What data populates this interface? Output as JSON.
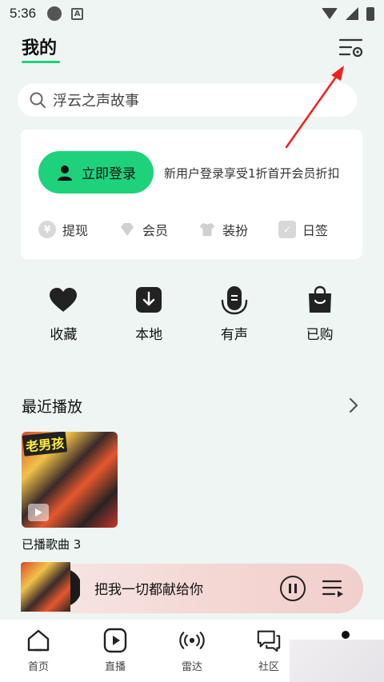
{
  "status_bar": {
    "time": "5:36",
    "a_icon_letter": "A"
  },
  "header": {
    "title": "我的",
    "accent_color": "#1ed27c"
  },
  "search": {
    "placeholder": "浮云之声故事"
  },
  "login_card": {
    "login_label": "立即登录",
    "promo_text": "新用户登录享受1折首开会员折扣",
    "quick_items": [
      {
        "label": "提现",
        "icon": "yen-icon"
      },
      {
        "label": "会员",
        "icon": "diamond-icon"
      },
      {
        "label": "装扮",
        "icon": "shirt-icon"
      },
      {
        "label": "日签",
        "icon": "checkbox-icon"
      }
    ]
  },
  "shortcuts": [
    {
      "label": "收藏",
      "icon": "heart-icon"
    },
    {
      "label": "本地",
      "icon": "download-icon"
    },
    {
      "label": "有声",
      "icon": "audiobook-icon"
    },
    {
      "label": "已购",
      "icon": "shopping-bag-icon"
    }
  ],
  "recent": {
    "title": "最近播放",
    "album_logo": "老男孩",
    "album_caption": "已播歌曲 3"
  },
  "player": {
    "song": "把我一切都献给你"
  },
  "tabs": [
    {
      "label": "首页",
      "icon": "home-icon"
    },
    {
      "label": "直播",
      "icon": "live-play-icon"
    },
    {
      "label": "雷达",
      "icon": "radar-icon"
    },
    {
      "label": "社区",
      "icon": "chat-icon"
    }
  ]
}
